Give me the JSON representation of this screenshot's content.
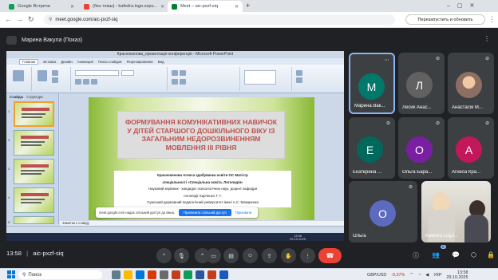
{
  "browser": {
    "tabs": [
      {
        "label": "Google Встреча",
        "favicon_color": "#0f9d58",
        "active": false
      },
      {
        "label": "(без темы) - kafedra.logo.szpu...",
        "favicon_color": "#ea4335",
        "active": false
      },
      {
        "label": "Meet – aic-pxzf-siq",
        "favicon_color": "#00832d",
        "active": true
      }
    ],
    "new_tab_glyph": "+",
    "url": "meet.google.com/aic-pxzf-siq",
    "restart_button": "Перезапустить и обновить"
  },
  "meet": {
    "presenter_label": "Марина Вакула (Показ)",
    "time": "13:58",
    "meeting_code": "aic-pxzf-siq",
    "participants_count": "9",
    "participants": [
      {
        "name": "Марина Вак...",
        "initial": "М",
        "color": "#00796b"
      },
      {
        "name": "Лесик Анас...",
        "initial": "Л",
        "color": "#616161"
      },
      {
        "name": "Анастасія М...",
        "initial": "",
        "color": "#a1887f"
      },
      {
        "name": "Екатерина ...",
        "initial": "Е",
        "color": "#00695c"
      },
      {
        "name": "Ольга Бара...",
        "initial": "О",
        "color": "#7b1fa2"
      },
      {
        "name": "Агнеса Кра...",
        "initial": "А",
        "color": "#c2185b"
      },
      {
        "name": "Ольга",
        "initial": "О",
        "color": "#5c6bc0"
      },
      {
        "name": "Kafedra Logo...",
        "initial": "",
        "color": "#8d8d8d"
      }
    ],
    "share_notice": {
      "text": "meet.google.com надає спільний доступ до вікна.",
      "stop_button": "Припинити спільний доступ",
      "hide_button": "Приховати"
    }
  },
  "ppt": {
    "window_title": "Красноконова_презентація конференція - Microsoft PowerPoint",
    "ribbon_tabs": [
      "Главная",
      "Вставка",
      "Дизайн",
      "Анимация",
      "Показ слайдов",
      "Рецензирование",
      "Вид"
    ],
    "pane_tabs": [
      "Слайды",
      "Структура"
    ],
    "slide_numbers": [
      "1",
      "2",
      "3",
      "4",
      "5"
    ],
    "notes_label": "Заметки к слайду",
    "slide": {
      "title": "ФОРМУВАННЯ КОМУНІКАТИВНИХ НАВИЧОК У ДІТЕЙ СТАРШОГО ДОШКІЛЬНОГО ВІКУ ІЗ ЗАГАЛЬНИМ НЕДОРОЗВИНЕННЯМ МОВЛЕННЯ ІІІ РІВНЯ",
      "author": "Красноконова Агнеса здобувачка освіти ОС Магістр",
      "specialty": "спеціальності «Спеціальна освіта. Логопедія»",
      "supervisor": "Науковий керівник - кандидат психологічних наук, доцент кафедри",
      "supervisor2": "логопедії Харченко Т. Г.",
      "university": "Сумський державний педагогічний університет імені А.С. Макаренка"
    },
    "win_time": "13:58",
    "win_date": "29.10.2025"
  },
  "taskbar": {
    "search_placeholder": "Поиск",
    "currency": "GBP/USD",
    "change": "-0,37%",
    "lang": "УКР",
    "time": "13:58",
    "date": "29.10.2025"
  }
}
